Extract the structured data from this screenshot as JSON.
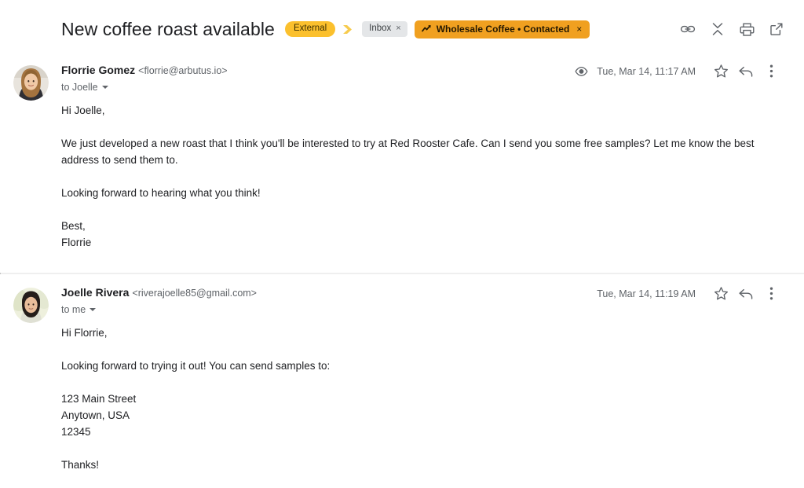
{
  "thread": {
    "subject": "New coffee roast available",
    "external_badge": "External",
    "inbox_chip": {
      "label": "Inbox",
      "remove": "×"
    },
    "crm_label": {
      "text": "Wholesale Coffee • Contacted",
      "remove": "×",
      "icon": "trending-up-icon",
      "color": "#F0A020"
    },
    "arrow_separator_color": "#F7CB4D",
    "external_badge_color": "#FBC02D",
    "header_actions": [
      {
        "name": "link-icon",
        "title": "Copy link"
      },
      {
        "name": "collapse-all-icon",
        "title": "Collapse all"
      },
      {
        "name": "print-icon",
        "title": "Print all"
      },
      {
        "name": "open-in-new-icon",
        "title": "Open in new window"
      }
    ]
  },
  "messages": [
    {
      "sender_name": "Florrie Gomez",
      "sender_email": "<florrie@arbutus.io>",
      "recipients": "to Joelle",
      "timestamp": "Tue, Mar 14, 11:17 AM",
      "tracked": true,
      "avatar": "avatar-florrie",
      "body": [
        "Hi Joelle,",
        "We just developed a new roast that I think you'll be interested to try at Red Rooster Cafe. Can I send you some free samples? Let me know the best address to send them to.",
        "Looking forward to hearing what you think!"
      ],
      "signoff": [
        "Best,",
        "Florrie"
      ],
      "actions": [
        {
          "name": "star-icon"
        },
        {
          "name": "reply-icon"
        },
        {
          "name": "more-options-icon"
        }
      ]
    },
    {
      "sender_name": "Joelle Rivera",
      "sender_email": "<riverajoelle85@gmail.com>",
      "recipients": "to me",
      "timestamp": "Tue, Mar 14, 11:19 AM",
      "tracked": false,
      "avatar": "avatar-joelle",
      "body": [
        "Hi Florrie,",
        "Looking forward to trying it out! You can send samples to:"
      ],
      "address": [
        "123 Main Street",
        "Anytown, USA",
        "12345"
      ],
      "closing": "Thanks!",
      "actions": [
        {
          "name": "star-icon"
        },
        {
          "name": "reply-icon"
        },
        {
          "name": "more-options-icon"
        }
      ]
    }
  ]
}
